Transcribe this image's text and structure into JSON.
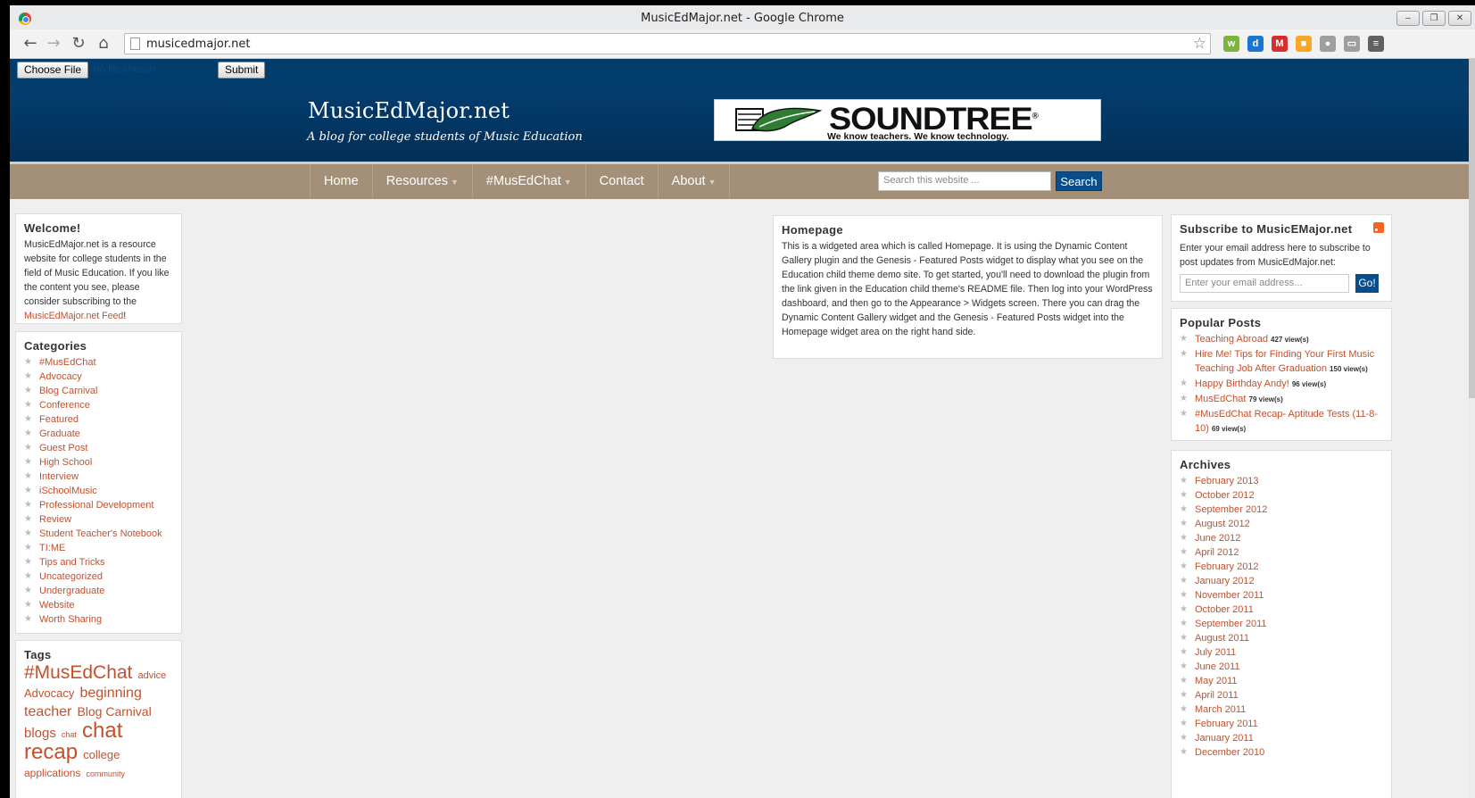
{
  "window": {
    "title": "MusicEdMajor.net - Google Chrome",
    "controls": [
      "–",
      "❐",
      "✕"
    ]
  },
  "toolbar": {
    "back": "←",
    "forward": "→",
    "reload": "↻",
    "home": "⌂",
    "url": "musicedmajor.net",
    "star": "☆",
    "extensions": [
      {
        "name": "evernote-icon",
        "label": "w",
        "color": "#7cb342"
      },
      {
        "name": "dropbox-icon",
        "label": "d",
        "color": "#1976d2"
      },
      {
        "name": "gmail-icon",
        "label": "M",
        "color": "#d32f2f"
      },
      {
        "name": "clip-icon",
        "label": "■",
        "color": "#f9a825"
      },
      {
        "name": "balloon-icon",
        "label": "●",
        "color": "#9e9e9e"
      },
      {
        "name": "cast-icon",
        "label": "▭",
        "color": "#9e9e9e"
      },
      {
        "name": "menu-icon",
        "label": "≡",
        "color": "#616161"
      }
    ]
  },
  "upload": {
    "choose_file": "Choose File",
    "no_file": "No file chosen",
    "submit": "Submit"
  },
  "site": {
    "title": "MusicEdMajor.net",
    "description": "A blog for college students of Music Education",
    "banner_name": "SOUNDTREE",
    "banner_tagline": "We know teachers. We know technology.",
    "registered": "®"
  },
  "nav": {
    "items": [
      {
        "label": "Home",
        "dropdown": false
      },
      {
        "label": "Resources",
        "dropdown": true
      },
      {
        "label": "#MusEdChat",
        "dropdown": true
      },
      {
        "label": "Contact",
        "dropdown": false
      },
      {
        "label": "About",
        "dropdown": true
      }
    ],
    "caret": "▼",
    "search_placeholder": "Search this website ...",
    "search_button": "Search"
  },
  "welcome": {
    "title": "Welcome!",
    "text": "MusicEdMajor.net is a resource website for college students in the field of Music Education. If you like the content you see, please consider subscribing to the ",
    "link": "MusicEdMajor.net Feed",
    "after": "!"
  },
  "categories": {
    "title": "Categories",
    "items": [
      "#MusEdChat",
      "Advocacy",
      "Blog Carnival",
      "Conference",
      "Featured",
      "Graduate",
      "Guest Post",
      "High School",
      "Interview",
      "iSchoolMusic",
      "Professional Development",
      "Review",
      "Student Teacher's Notebook",
      "TI:ME",
      "Tips and Tricks",
      "Uncategorized",
      "Undergraduate",
      "Website",
      "Worth Sharing"
    ]
  },
  "tags": {
    "title": "Tags",
    "items": [
      {
        "label": "#MusEdChat",
        "size": 21
      },
      {
        "label": "advice",
        "size": 11
      },
      {
        "label": "Advocacy",
        "size": 13
      },
      {
        "label": "beginning teacher",
        "size": 16
      },
      {
        "label": "Blog Carnival",
        "size": 14
      },
      {
        "label": "blogs",
        "size": 15
      },
      {
        "label": "chat",
        "size": 9
      },
      {
        "label": "chat recap",
        "size": 24
      },
      {
        "label": "college",
        "size": 13
      },
      {
        "label": "applications",
        "size": 12
      },
      {
        "label": "community",
        "size": 9
      }
    ]
  },
  "homepage": {
    "title": "Homepage",
    "text": "This is a widgeted area which is called Homepage. It is using the Dynamic Content Gallery plugin and the Genesis - Featured Posts widget to display what you see on the Education child theme demo site. To get started, you'll need to download the plugin from the link given in the Education child theme's README file. Then log into your WordPress dashboard, and then go to the Appearance > Widgets screen. There you can drag the Dynamic Content Gallery widget and the Genesis - Featured Posts widget into the Homepage widget area on the right hand side."
  },
  "subscribe": {
    "title": "Subscribe to MusicEMajor.net",
    "text": "Enter your email address here to subscribe to post updates from MusicEdMajor.net:",
    "placeholder": "Enter your email address...",
    "button": "Go!"
  },
  "popular": {
    "title": "Popular Posts",
    "items": [
      {
        "title": "Teaching Abroad",
        "views": "427 view(s)"
      },
      {
        "title": "Hire Me! Tips for Finding Your First Music Teaching Job After Graduation",
        "views": "150 view(s)"
      },
      {
        "title": "Happy Birthday Andy!",
        "views": "96 view(s)"
      },
      {
        "title": "MusEdChat",
        "views": "79 view(s)"
      },
      {
        "title": "#MusEdChat Recap- Aptitude Tests (11-8-10)",
        "views": "69 view(s)"
      }
    ]
  },
  "archives": {
    "title": "Archives",
    "items": [
      "February 2013",
      "October 2012",
      "September 2012",
      "August 2012",
      "June 2012",
      "April 2012",
      "February 2012",
      "January 2012",
      "November 2011",
      "October 2011",
      "September 2011",
      "August 2011",
      "July 2011",
      "June 2011",
      "May 2011",
      "April 2011",
      "March 2011",
      "February 2011",
      "January 2011",
      "December 2010"
    ]
  },
  "colors": {
    "header_blue": "#043e70",
    "nav_tan": "#a48f78",
    "link": "#c5502c",
    "button_blue": "#0a4d8b"
  }
}
